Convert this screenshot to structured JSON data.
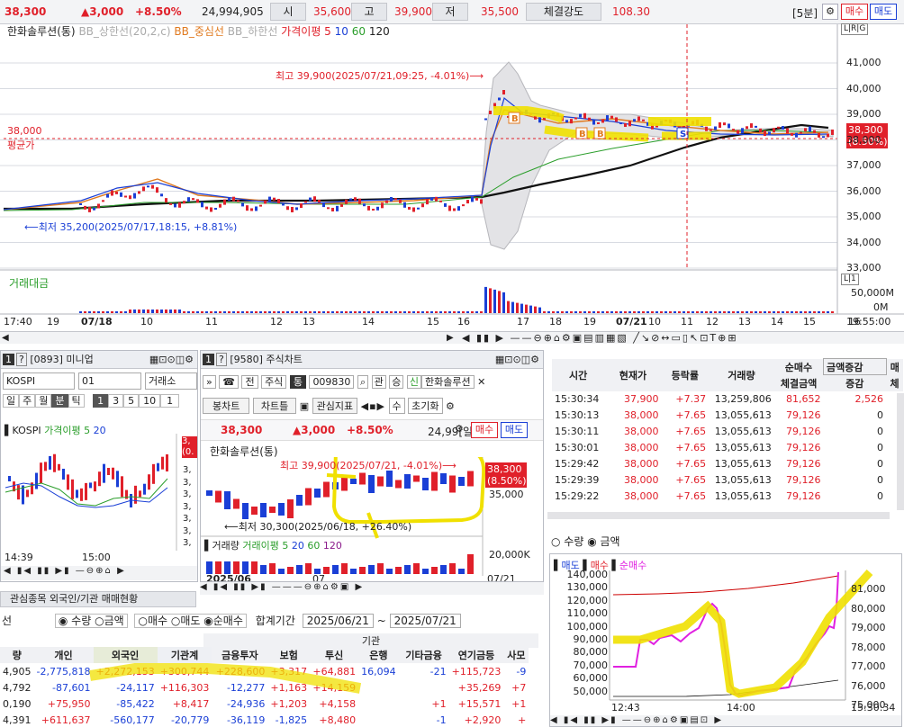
{
  "header": {
    "price": "38,300",
    "change": "▲3,000",
    "change_pct": "+8.50%",
    "volume": "24,994,905",
    "open_label": "시",
    "open": "35,600",
    "high_label": "고",
    "high": "39,900",
    "low_label": "저",
    "low": "35,500",
    "strength_label": "체결강도",
    "strength": "108.30",
    "period": "[5분]",
    "buy": "매수",
    "sell": "매도"
  },
  "main_chart": {
    "stock": "한화솔루션(통)",
    "legend": [
      "BB_상한선(20,2,c)",
      "BB_중심선",
      "BB_하한선",
      "가격이평 5",
      "10",
      "60",
      "120"
    ],
    "high_note": "최고 39,900(2025/07/21,09:25, -4.01%)⟶",
    "low_note": "⟵최저 35,200(2025/07/17,18:15, +8.81%)",
    "avg_value": "38,000",
    "avg_label": "평균가",
    "cur_price": "38,300",
    "cur_pct": "(8.50%)",
    "y_ticks": [
      "41,000",
      "40,000",
      "39,000",
      "38,000",
      "37,000",
      "36,000",
      "35,000",
      "34,000",
      "33,000"
    ],
    "x_ticks": [
      "17:40",
      "19",
      "07/18",
      "10",
      "11",
      "12",
      "13",
      "14",
      "15",
      "16",
      "17",
      "18",
      "19",
      "07/21",
      "10",
      "11",
      "12",
      "13",
      "14",
      "15",
      "16",
      "17",
      "18",
      "19",
      "19:55:00"
    ],
    "volume_label": "거래대금",
    "volume_ticks": [
      "50,000M",
      "0M"
    ],
    "lr_tag": "L|R|G",
    "lr_tag2": "L|1"
  },
  "mini_panel": {
    "id": "[0893] 미니업",
    "market": "KOSPI",
    "code": "01",
    "exchange": "거래소",
    "periods": [
      "일",
      "주",
      "월",
      "분",
      "틱"
    ],
    "nums": [
      "1",
      "3",
      "5",
      "10",
      "1"
    ],
    "legend_name": "KOSPI",
    "legend_ma": "가격이평 5",
    "legend_20": "20",
    "x_ticks": [
      "14:39",
      "15:00"
    ],
    "y_ticks": [
      "3,",
      "3,",
      "3,",
      "3,",
      "3,",
      "3,",
      "3,"
    ],
    "red_tag": "3,",
    "red_tag2": "(0."
  },
  "stock_panel": {
    "id": "[9580] 주식차트",
    "tabs": [
      "주식",
      "통"
    ],
    "code": "009830",
    "name": "한화솔루션",
    "chips": [
      "관",
      "승",
      "신"
    ],
    "btns": [
      "봉차트",
      "차트틀",
      "관심지표",
      "수",
      "초기화"
    ],
    "price": "38,300",
    "change": "▲3,000",
    "change_pct": "+8.50%",
    "days": "24,99[일]",
    "buy": "매수",
    "sell": "매도",
    "stock": "한화솔루션(통)",
    "high_note": "최고 39,900(2025/07/21, -4.01%)⟶",
    "low_note": "⟵최저 30,300(2025/06/18, +26.40%)",
    "cur_price": "38,300",
    "cur_pct": "(8.50%)",
    "y_tick": "35,000",
    "vol_legend": [
      "거래량",
      "거래이평 5",
      "20",
      "60",
      "120"
    ],
    "vol_tick": "20,000K",
    "x_left": "2025/06",
    "x_mid": "07",
    "x_right": "07/21"
  },
  "ticks": {
    "headers": [
      "시간",
      "현재가",
      "등락률",
      "거래량",
      "순매수",
      "금액증감",
      "매"
    ],
    "subheaders": [
      "체결금액",
      "증감",
      "체"
    ],
    "rows": [
      [
        "15:30:34",
        "37,900",
        "+7.37",
        "13,259,806",
        "81,652",
        "2,526"
      ],
      [
        "15:30:13",
        "38,000",
        "+7.65",
        "13,055,613",
        "79,126",
        "0"
      ],
      [
        "15:30:11",
        "38,000",
        "+7.65",
        "13,055,613",
        "79,126",
        "0"
      ],
      [
        "15:30:01",
        "38,000",
        "+7.65",
        "13,055,613",
        "79,126",
        "0"
      ],
      [
        "15:29:42",
        "38,000",
        "+7.65",
        "13,055,613",
        "79,126",
        "0"
      ],
      [
        "15:29:39",
        "38,000",
        "+7.65",
        "13,055,613",
        "79,126",
        "0"
      ],
      [
        "15:29:22",
        "38,000",
        "+7.65",
        "13,055,613",
        "79,126",
        "0"
      ]
    ],
    "radio": [
      "수량",
      "금액"
    ]
  },
  "flow_chart": {
    "legend": [
      "매도",
      "매수",
      "순매수"
    ],
    "y_left": [
      "140,000",
      "130,000",
      "120,000",
      "110,000",
      "100,000",
      "90,000",
      "80,000",
      "70,000",
      "60,000",
      "50,000"
    ],
    "y_right": [
      "81,000",
      "80,000",
      "79,000",
      "78,000",
      "77,000",
      "76,000",
      "75,000"
    ],
    "x_ticks": [
      "12:43",
      "14:00",
      "15:30:34"
    ]
  },
  "investor": {
    "tab": "관심종목 외국인/기관 매매현황",
    "radio1": [
      "수량",
      "금액"
    ],
    "radio2": [
      "매수",
      "매도",
      "순매수"
    ],
    "period_label": "합계기간",
    "from": "2025/06/21",
    "to": "2025/07/21",
    "sel": "선",
    "headers": [
      "량",
      "개인",
      "외국인",
      "기관계",
      "금융투자",
      "보험",
      "투신",
      "은행",
      "기타금융",
      "연기금등",
      "사모"
    ],
    "group": "기관",
    "rows": [
      [
        "4,905",
        "-2,775,818",
        "+2,272,153",
        "+300,744",
        "+228,600",
        "+3,317",
        "+64,881",
        "16,094",
        "-21",
        "+115,723",
        "-9"
      ],
      [
        "4,792",
        "-87,601",
        "-24,117",
        "+116,303",
        "-12,277",
        "+1,163",
        "+14,159",
        "",
        "",
        "+35,269",
        "+7"
      ],
      [
        "0,190",
        "+75,950",
        "-85,422",
        "+8,417",
        "-24,936",
        "+1,203",
        "+4,158",
        "",
        "+1",
        "+15,571",
        "+1"
      ],
      [
        "4,391",
        "+611,637",
        "-560,177",
        "-20,779",
        "-36,119",
        "-1,825",
        "+8,480",
        "",
        "-1",
        "+2,920",
        "+"
      ]
    ]
  }
}
